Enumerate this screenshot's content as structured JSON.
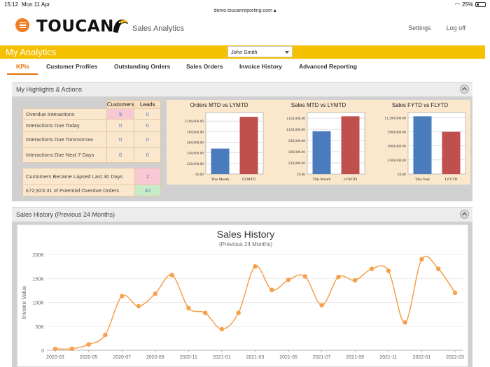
{
  "status": {
    "time": "15:12",
    "date": "Mon 11 Apr",
    "battery": "25%",
    "url": "demo.toucanreporting.com"
  },
  "header": {
    "logo": "TOUCAN",
    "app_title": "Sales Analytics",
    "nav": [
      "Settings",
      "Log off"
    ]
  },
  "topbar": {
    "title": "My Analytics",
    "user_selected": "John Smith"
  },
  "tabs": [
    "KPIs",
    "Customer Profiles",
    "Outstanding Orders",
    "Sales Orders",
    "Invoice History",
    "Advanced Reporting"
  ],
  "highlights": {
    "title": "My Highlights & Actions",
    "columns": [
      "Customers",
      "Leads"
    ],
    "rows": [
      {
        "label": "Overdue Interactions",
        "customers": "9",
        "leads": "0"
      },
      {
        "label": "Interactions Due Today",
        "customers": "0",
        "leads": "0"
      },
      {
        "label": "Interactions Due Tommorrow",
        "customers": "0",
        "leads": "0"
      },
      {
        "label": "Interactions Due Next 7 Days",
        "customers": "0",
        "leads": "0"
      }
    ],
    "extra": [
      {
        "label": "Customers Became Lapsed Last 30 Days",
        "value": "2"
      },
      {
        "label": "£72,923.31 of Potential Overdue Orders",
        "value": "40"
      }
    ]
  },
  "colors": {
    "accent": "#e8720c",
    "yellow": "#f5c000",
    "bar_blue": "#4a7bbd",
    "bar_red": "#c0504d",
    "line": "#f5a04a"
  },
  "chart_data": [
    {
      "type": "bar",
      "title": "Orders MTD vs LYMTD",
      "categories": [
        "This Month",
        "LYMTD"
      ],
      "values": [
        48000,
        108000
      ],
      "yticks": [
        "£0.00",
        "£20,000.00",
        "£40,000.00",
        "£60,000.00",
        "£80,000.00",
        "£100,000.00"
      ],
      "ylim": [
        0,
        116000
      ]
    },
    {
      "type": "bar",
      "title": "Sales MTD vs LYMTD",
      "categories": [
        "This Month",
        "LYMTD"
      ],
      "values": [
        115000,
        155000
      ],
      "yticks": [
        "£0.00",
        "£30,000.00",
        "£60,000.00",
        "£90,000.00",
        "£120,000.00",
        "£150,000.00"
      ],
      "ylim": [
        0,
        165000
      ]
    },
    {
      "type": "bar",
      "title": "Sales FYTD vs FLYTD",
      "categories": [
        "This Year",
        "LFYTD"
      ],
      "values": [
        1230000,
        900000
      ],
      "yticks": [
        "£0.00",
        "£300,000.00",
        "£600,000.00",
        "£900,000.00",
        "£1,200,000.00"
      ],
      "ylim": [
        0,
        1310000
      ]
    },
    {
      "type": "line",
      "panel_title": "Sales History (Previous 24 Months)",
      "title": "Sales History",
      "subtitle": "(Previous 24 Months)",
      "ylabel": "Invoice Value",
      "ylim": [
        0,
        200000
      ],
      "yticks": [
        "0",
        "50K",
        "100K",
        "150K",
        "200K"
      ],
      "xticks": [
        "2020-03",
        "2020-05",
        "2020-07",
        "2020-09",
        "2020-11",
        "2021-01",
        "2021-03",
        "2021-05",
        "2021-07",
        "2021-09",
        "2021-11",
        "2022-01",
        "2022-03"
      ],
      "x": [
        "2020-03",
        "2020-04",
        "2020-05",
        "2020-06",
        "2020-07",
        "2020-08",
        "2020-09",
        "2020-10",
        "2020-11",
        "2020-12",
        "2021-01",
        "2021-02",
        "2021-03",
        "2021-04",
        "2021-05",
        "2021-06",
        "2021-07",
        "2021-08",
        "2021-09",
        "2021-10",
        "2021-11",
        "2021-12",
        "2022-01",
        "2022-02",
        "2022-03"
      ],
      "values": [
        3000,
        3000,
        12000,
        32000,
        113000,
        92000,
        118000,
        157000,
        88000,
        78000,
        44000,
        78000,
        175000,
        126000,
        147000,
        154000,
        94000,
        153000,
        146000,
        170000,
        166000,
        58000,
        190000,
        170000,
        120000
      ]
    }
  ]
}
